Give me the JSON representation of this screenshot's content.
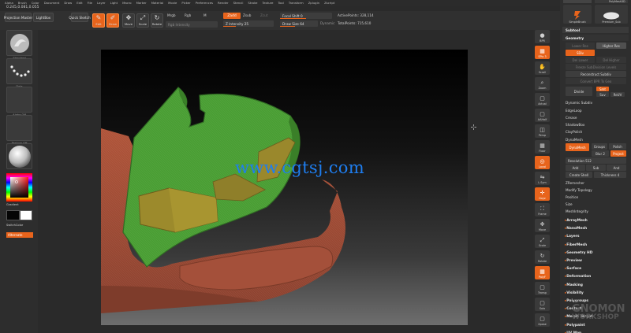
{
  "menu": [
    "Alpha",
    "Brush",
    "Color",
    "Document",
    "Draw",
    "Edit",
    "File",
    "Layer",
    "Light",
    "Macro",
    "Marker",
    "Material",
    "Movie",
    "Picker",
    "Preferences",
    "Render",
    "Stencil",
    "Stroke",
    "Texture",
    "Tool",
    "Transform",
    "Zplugin",
    "Zscript"
  ],
  "coords": "0.245,0.081,0.055",
  "toolbar": {
    "projection_master": "Projection Master",
    "lightbox": "LightBox",
    "quick_sketch": "Quick Sketch",
    "edit": "Edit",
    "draw": "Draw",
    "move": "Move",
    "scale": "Scale",
    "rotate": "Rotate",
    "mrgb": "Mrgb",
    "rgb": "Rgb",
    "m": "M",
    "rgb_intensity": "Rgb Intensity",
    "zadd": "Zadd",
    "zsub": "Zsub",
    "zcut": "Zcut",
    "z_intensity": "Z Intensity 25",
    "focal_shift": "Focal Shift 0",
    "draw_size": "Draw Size 64",
    "dynamic": "Dynamic",
    "active_points": "ActivePoints: 328,114",
    "total_points": "TotalPoints: 715,610"
  },
  "left": {
    "brush_label": "Standard",
    "stroke_label": "Dots",
    "alpha_label": "Alpha Off",
    "texture_label": "Texture Off",
    "material_label": "MatCap Gray",
    "gradient": "Gradient",
    "switch_color": "SwitchColor",
    "alternate": "Alternate"
  },
  "canvas": {
    "watermark": "www.cgtsj.com",
    "colors": {
      "green": "#4a9e34",
      "terracotta": "#9c4a34",
      "ochre": "#9c8a2c"
    }
  },
  "right_shelf": [
    {
      "label": "BPR",
      "icon": "sphere"
    },
    {
      "label": "SPix 3",
      "icon": "grid"
    },
    {
      "label": "Scroll",
      "icon": "hand"
    },
    {
      "label": "Zoom",
      "icon": "magnifier"
    },
    {
      "label": "Actual",
      "icon": "box"
    },
    {
      "label": "AAHalf",
      "icon": "box"
    },
    {
      "label": "Persp",
      "icon": "cube"
    },
    {
      "label": "Floor",
      "icon": "grid"
    },
    {
      "label": "Local",
      "icon": "target"
    },
    {
      "label": "L.Sym",
      "icon": "sym"
    },
    {
      "label": "Gxyz",
      "icon": "axes"
    },
    {
      "label": "Frame",
      "icon": "frame"
    },
    {
      "label": "Move",
      "icon": "move"
    },
    {
      "label": "Scale",
      "icon": "scale"
    },
    {
      "label": "Rotate",
      "icon": "rotate"
    },
    {
      "label": "PolyF",
      "icon": "grid"
    },
    {
      "label": "Transp",
      "icon": "box"
    },
    {
      "label": "Solo",
      "icon": "box"
    },
    {
      "label": "Xpose",
      "icon": "box"
    }
  ],
  "panel": {
    "tool_thumbs": [
      "DynaWax",
      "PolyMesh3D",
      "SimpleBrush",
      "Premium_Sub"
    ],
    "subtool": "Subtool",
    "geometry": "Geometry",
    "lower_res": "Lower Res",
    "higher_res": "Higher Res",
    "sdiv": "SDiv",
    "del_lower": "Del Lower",
    "del_higher": "Del Higher",
    "freeze_subdiv": "Freeze SubDivision Levels",
    "reconstruct_subdiv": "Reconstruct Subdiv",
    "convert_bpr": "Convert BPR To Geo",
    "divide": "Divide",
    "smt": "Smt",
    "suv": "Suv",
    "relt": "ReUV",
    "dynamic_subdiv": "Dynamic Subdiv",
    "edgeloop": "EdgeLoop",
    "crease": "Crease",
    "shadowbox": "ShadowBox",
    "claypolish": "ClayPolish",
    "dynamesh_section": "DynaMesh",
    "dynamesh_btn": "DynaMesh",
    "groups": "Groups",
    "polish": "Polish",
    "blur": "Blur 2",
    "project": "Project",
    "resolution": "Resolution 512",
    "add": "Add",
    "sub": "Sub",
    "and": "And",
    "create_shell": "Create Shell",
    "thickness": "Thickness 4",
    "zremesher": "ZRemesher",
    "modify_topology": "Modify Topology",
    "position": "Position",
    "size": "Size",
    "meshintegrity": "MeshIntegrity",
    "sections": [
      "ArrayMesh",
      "NanoMesh",
      "Layers",
      "FiberMesh",
      "Geometry HD",
      "Preview",
      "Surface",
      "Deformation",
      "Masking",
      "Visibility",
      "Polygroups",
      "Contact",
      "Morph Target",
      "Polypaint",
      "UV Map"
    ]
  },
  "logo": {
    "line1": "THE",
    "line2": "GNOMON",
    "line3": "WORKSHOP"
  }
}
